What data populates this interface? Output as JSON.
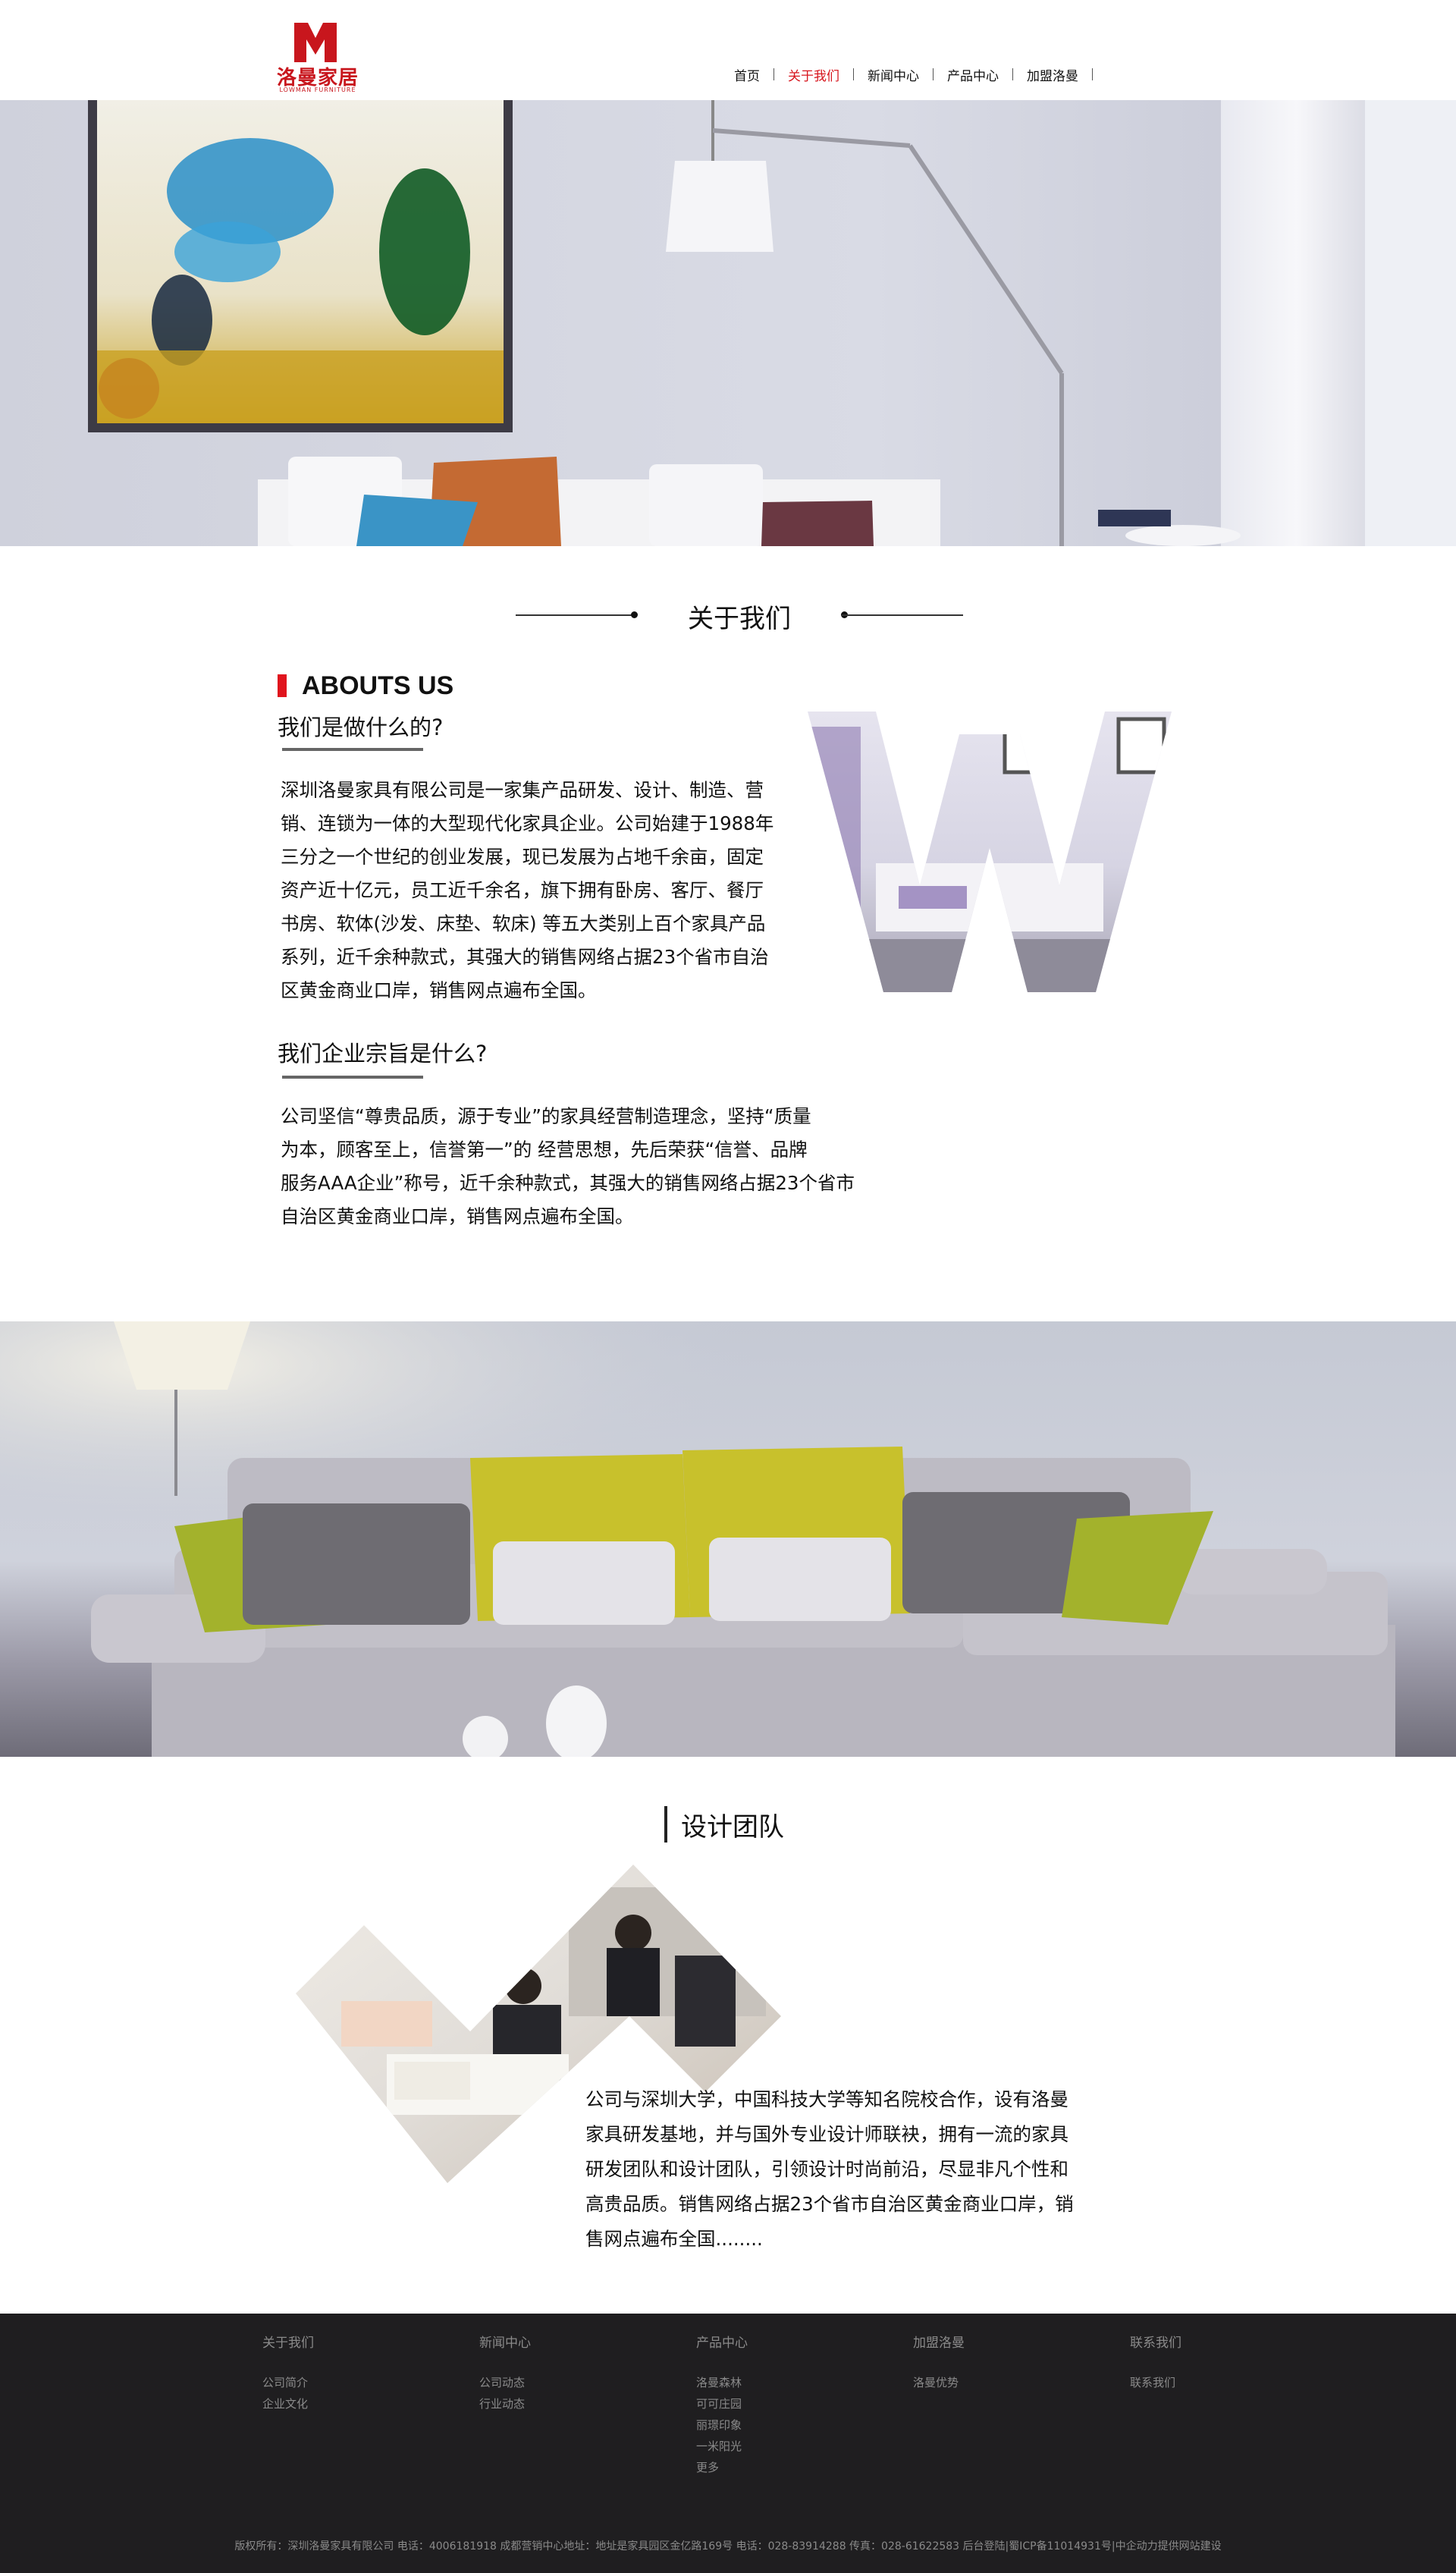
{
  "header": {
    "logo_cn": "洛曼家居",
    "logo_en": "LOWMAN FURNITURE",
    "nav": [
      {
        "label": "首页",
        "active": false
      },
      {
        "label": "关于我们",
        "active": true
      },
      {
        "label": "新闻中心",
        "active": false
      },
      {
        "label": "产品中心",
        "active": false
      },
      {
        "label": "加盟洛曼",
        "active": false
      }
    ]
  },
  "about": {
    "section_title": "关于我们",
    "en_title": "ABOUTS US",
    "q1": "我们是做什么的?",
    "p1_lines": [
      "深圳洛曼家具有限公司是一家集产品研发、设计、制造、营",
      "销、连锁为一体的大型现代化家具企业。公司始建于1988年",
      "三分之一个世纪的创业发展，现已发展为占地千余亩，固定",
      "资产近十亿元，员工近千余名，旗下拥有卧房、客厅、餐厅",
      "书房、软体(沙发、床垫、软床) 等五大类别上百个家具产品",
      "系列，近千余种款式，其强大的销售网络占据23个省市自治",
      "区黄金商业口岸，销售网点遍布全国。"
    ],
    "q2": "我们企业宗旨是什么?",
    "p2_lines": [
      "公司坚信“尊贵品质，源于专业”的家具经营制造理念，坚持“质量",
      "为本，顾客至上，信誉第一”的 经营思想，先后荣获“信誉、品牌",
      "服务AAA企业”称号，近千余种款式，其强大的销售网络占据23个省市",
      "自治区黄金商业口岸，销售网点遍布全国。"
    ]
  },
  "team": {
    "title": "设计团队",
    "lines": [
      "公司与深圳大学，中国科技大学等知名院校合作，设有洛曼",
      "家具研发基地，并与国外专业设计师联袂，拥有一流的家具",
      "研发团队和设计团队，引领设计时尚前沿，尽显非凡个性和",
      "高贵品质。销售网络占据23个省市自治区黄金商业口岸，销",
      "售网点遍布全国........"
    ]
  },
  "footer": {
    "cols": [
      {
        "head": "关于我们",
        "links": [
          "公司简介",
          "企业文化"
        ]
      },
      {
        "head": "新闻中心",
        "links": [
          "公司动态",
          "行业动态"
        ]
      },
      {
        "head": "产品中心",
        "links": [
          "洛曼森林",
          "可可庄园",
          "丽璟印象",
          "一米阳光",
          "更多"
        ]
      },
      {
        "head": "加盟洛曼",
        "links": [
          "洛曼优势"
        ]
      },
      {
        "head": "联系我们",
        "links": [
          "联系我们"
        ]
      }
    ],
    "copyright": "版权所有：深圳洛曼家具有限公司 电话：4006181918 成都营销中心地址：地址是家具园区金亿路169号 电话：028-83914288 传真：028-61622583 后台登陆|蜀ICP备11014931号|中企动力提供网站建设"
  }
}
